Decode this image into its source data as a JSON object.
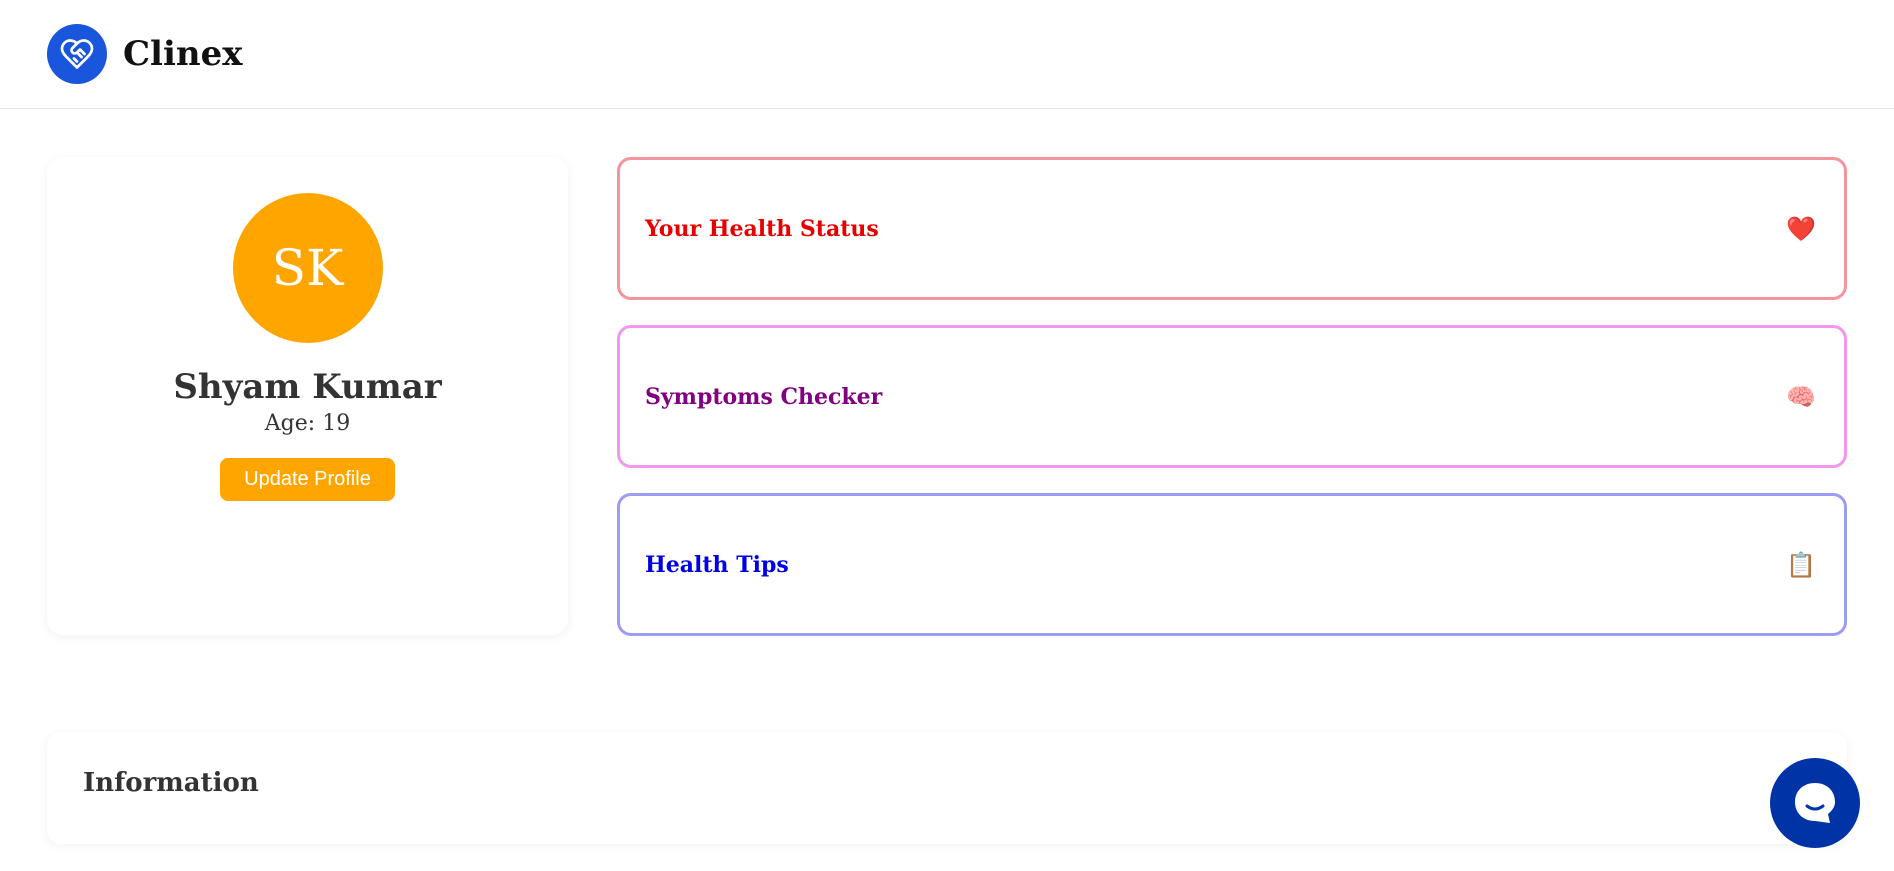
{
  "header": {
    "logo_icon": "heart-handshake-icon",
    "brand": "Clinex",
    "accent": "#1a56db"
  },
  "profile": {
    "initials": "SK",
    "name": "Shyam Kumar",
    "age": "Age: 19",
    "update_label": "Update Profile",
    "accent": "#ffa500"
  },
  "features": [
    {
      "title": "Your Health Status",
      "icon": "heart-icon",
      "glyph": "❤️",
      "color": "#e60000"
    },
    {
      "title": "Symptoms Checker",
      "icon": "brain-icon",
      "glyph": "🧠",
      "color": "#800080"
    },
    {
      "title": "Health Tips",
      "icon": "clipboard-icon",
      "glyph": "📋",
      "color": "#0000e6"
    }
  ],
  "info": {
    "title": "Information"
  },
  "chat": {
    "icon": "chat-bubble-icon",
    "color": "#0033a6"
  }
}
